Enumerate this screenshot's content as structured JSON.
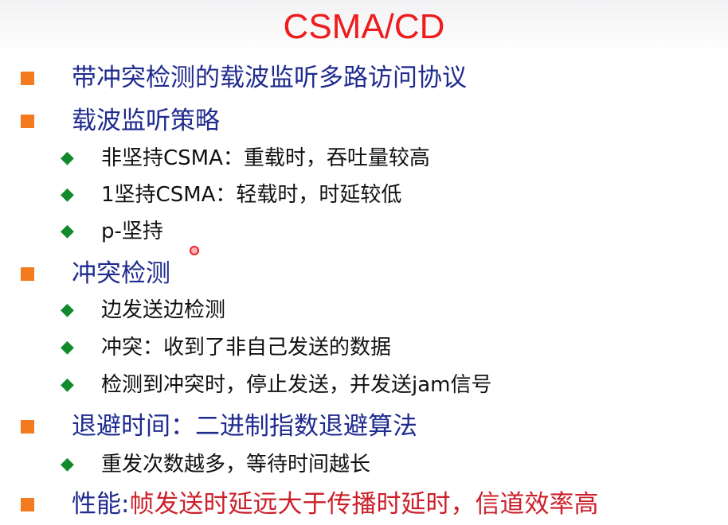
{
  "title": "CSMA/CD",
  "items": [
    {
      "text": "带冲突检测的载波监听多路访问协议"
    },
    {
      "text": "载波监听策略"
    },
    {
      "text": "非坚持CSMA：重载时，吞吐量较高"
    },
    {
      "text": "1坚持CSMA：轻载时，时延较低"
    },
    {
      "text": "p-坚持"
    },
    {
      "text": "冲突检测"
    },
    {
      "text": "边发送边检测"
    },
    {
      "text": "冲突：收到了非自己发送的数据"
    },
    {
      "text": "检测到冲突时，停止发送，并发送jam信号"
    },
    {
      "text": "退避时间：二进制指数退避算法"
    },
    {
      "text": "重发次数越多，等待时间越长"
    },
    {
      "label": "性能:",
      "text": "帧发送时延远大于传播时延时，信道效率高"
    }
  ],
  "bullets": {
    "level1": "■",
    "level2": "◆"
  },
  "colors": {
    "title": "#ee1c1c",
    "level1_text": "#1f2b8f",
    "level1_bullet": "#f47a20",
    "level2_text": "#111111",
    "level2_bullet": "#118a2b",
    "accent_text": "#cc1f2a"
  }
}
